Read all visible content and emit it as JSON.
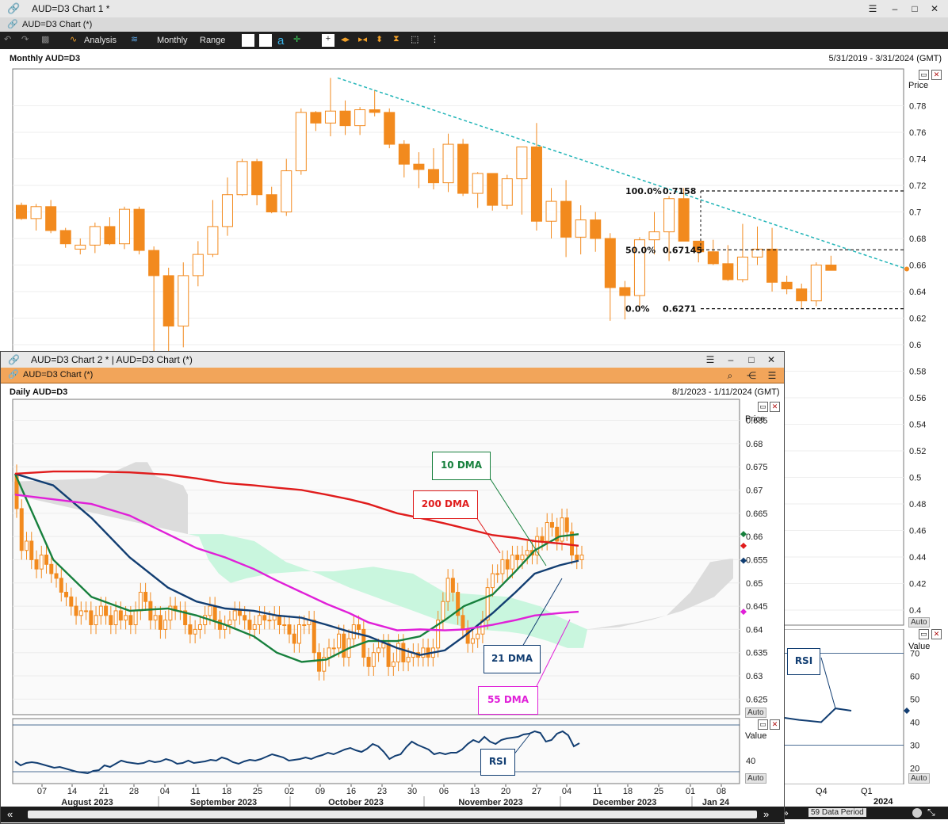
{
  "window1": {
    "title": "AUD=D3 Chart 1 *",
    "subtitle": "AUD=D3 Chart (*)",
    "toolbar": {
      "analysis": "Analysis",
      "interval": "Monthly",
      "range": "Range"
    },
    "chart_title": "Monthly AUD=D3",
    "date_range": "5/31/2019 - 3/31/2024 (GMT)",
    "price_label": "Price",
    "auto_label": "Auto",
    "rsi_value_label": "Value",
    "rsi_label": "RSI",
    "data_period": "59 Data Period",
    "x_labels_visible": [
      "Q4",
      "Q1",
      "2024"
    ],
    "fib_levels": [
      {
        "pct": "100.0%",
        "value": "0.7158"
      },
      {
        "pct": "50.0%",
        "value": "0.67145"
      },
      {
        "pct": "0.0%",
        "value": "0.6271"
      }
    ]
  },
  "window2": {
    "title": "AUD=D3 Chart 2 * | AUD=D3 Chart (*)",
    "subtitle": "AUD=D3 Chart (*)",
    "chart_title": "Daily AUD=D3",
    "date_range": "8/1/2023 - 1/11/2024 (GMT)",
    "price_label": "Price",
    "auto_label": "Auto",
    "rsi_value_label": "Value",
    "rsi_label": "RSI",
    "annotations": {
      "dma10": "10 DMA",
      "dma200": "200 DMA",
      "dma21": "21 DMA",
      "dma55": "55 DMA"
    },
    "months": [
      "August 2023",
      "September 2023",
      "October 2023",
      "November 2023",
      "December 2023",
      "Jan 24"
    ]
  },
  "colors": {
    "candle": "#f28a1e",
    "trendline": "#22b5b8",
    "dma10": "#17803d",
    "dma200": "#e01c1c",
    "dma21": "#123e72",
    "dma55": "#e020d8",
    "cloud": "#c9f6de",
    "cloud_future": "#dcdcdc",
    "rsi": "#123e72"
  },
  "chart_data": [
    {
      "type": "candlestick",
      "title": "Monthly AUD=D3",
      "ylabel": "Price",
      "ylim": [
        0.4,
        0.8
      ],
      "yticks": [
        0.78,
        0.76,
        0.74,
        0.72,
        0.7,
        0.68,
        0.66,
        0.64,
        0.62,
        0.6,
        0.58,
        0.56,
        0.54,
        0.52,
        0.5,
        0.48,
        0.46,
        0.44,
        0.42,
        0.4
      ],
      "yticks_labels": [
        "0.78",
        "0.76",
        "0.74",
        "0.72",
        "0.7",
        "0.68",
        "0.66",
        "0.64",
        "0.62",
        "0.6",
        "0.58",
        "0.56",
        "0.54",
        "0.52",
        "0.5",
        "0.48",
        "0.46",
        "0.44",
        "0.42",
        "0.4"
      ],
      "candles_ohlc": [
        [
          0.705,
          0.707,
          0.694,
          0.695
        ],
        [
          0.695,
          0.706,
          0.686,
          0.704
        ],
        [
          0.704,
          0.709,
          0.684,
          0.686
        ],
        [
          0.686,
          0.688,
          0.673,
          0.676
        ],
        [
          0.672,
          0.68,
          0.668,
          0.675
        ],
        [
          0.675,
          0.692,
          0.669,
          0.689
        ],
        [
          0.689,
          0.696,
          0.675,
          0.676
        ],
        [
          0.676,
          0.704,
          0.672,
          0.702
        ],
        [
          0.702,
          0.704,
          0.668,
          0.671
        ],
        [
          0.671,
          0.674,
          0.595,
          0.652
        ],
        [
          0.652,
          0.658,
          0.574,
          0.614
        ],
        [
          0.614,
          0.662,
          0.598,
          0.652
        ],
        [
          0.652,
          0.678,
          0.644,
          0.668
        ],
        [
          0.668,
          0.709,
          0.666,
          0.689
        ],
        [
          0.689,
          0.726,
          0.682,
          0.713
        ],
        [
          0.713,
          0.74,
          0.712,
          0.738
        ],
        [
          0.738,
          0.74,
          0.705,
          0.713
        ],
        [
          0.713,
          0.719,
          0.699,
          0.7
        ],
        [
          0.7,
          0.74,
          0.697,
          0.731
        ],
        [
          0.731,
          0.778,
          0.728,
          0.775
        ],
        [
          0.775,
          0.776,
          0.761,
          0.767
        ],
        [
          0.767,
          0.801,
          0.757,
          0.776
        ],
        [
          0.776,
          0.784,
          0.758,
          0.765
        ],
        [
          0.765,
          0.779,
          0.758,
          0.777
        ],
        [
          0.777,
          0.792,
          0.772,
          0.775
        ],
        [
          0.775,
          0.778,
          0.748,
          0.751
        ],
        [
          0.751,
          0.754,
          0.726,
          0.736
        ],
        [
          0.736,
          0.745,
          0.718,
          0.732
        ],
        [
          0.732,
          0.748,
          0.717,
          0.722
        ],
        [
          0.722,
          0.759,
          0.715,
          0.751
        ],
        [
          0.751,
          0.755,
          0.712,
          0.714
        ],
        [
          0.714,
          0.73,
          0.703,
          0.729
        ],
        [
          0.729,
          0.729,
          0.701,
          0.705
        ],
        [
          0.705,
          0.728,
          0.702,
          0.725
        ],
        [
          0.725,
          0.732,
          0.698,
          0.749
        ],
        [
          0.749,
          0.767,
          0.686,
          0.693
        ],
        [
          0.693,
          0.718,
          0.68,
          0.708
        ],
        [
          0.708,
          0.724,
          0.666,
          0.681
        ],
        [
          0.681,
          0.705,
          0.668,
          0.694
        ],
        [
          0.694,
          0.7,
          0.67,
          0.68
        ],
        [
          0.68,
          0.684,
          0.618,
          0.643
        ],
        [
          0.643,
          0.648,
          0.619,
          0.637
        ],
        [
          0.637,
          0.681,
          0.628,
          0.679
        ],
        [
          0.679,
          0.7,
          0.668,
          0.685
        ],
        [
          0.685,
          0.712,
          0.663,
          0.71
        ],
        [
          0.71,
          0.718,
          0.68,
          0.678
        ],
        [
          0.678,
          0.678,
          0.662,
          0.67
        ],
        [
          0.67,
          0.679,
          0.66,
          0.661
        ],
        [
          0.661,
          0.675,
          0.648,
          0.649
        ],
        [
          0.649,
          0.691,
          0.647,
          0.666
        ],
        [
          0.666,
          0.689,
          0.66,
          0.672
        ],
        [
          0.672,
          0.688,
          0.64,
          0.647
        ],
        [
          0.647,
          0.652,
          0.638,
          0.642
        ],
        [
          0.642,
          0.646,
          0.627,
          0.633
        ],
        [
          0.633,
          0.662,
          0.629,
          0.66
        ],
        [
          0.66,
          0.667,
          0.657,
          0.656
        ]
      ],
      "trendline": {
        "from_price": 0.801,
        "to_price": 0.657
      },
      "fibonacci": [
        {
          "label": "100.0%",
          "value": 0.7158
        },
        {
          "label": "50.0%",
          "value": 0.67145
        },
        {
          "label": "0.0%",
          "value": 0.6271
        }
      ],
      "rsi": {
        "ylabel": "Value",
        "yticks": [
          70,
          60,
          50,
          40,
          30,
          20
        ],
        "levels": [
          70,
          30
        ],
        "visible_values": [
          42,
          41,
          40,
          46,
          45
        ]
      }
    },
    {
      "type": "candlestick",
      "title": "Daily AUD=D3",
      "ylabel": "Price",
      "ylim": [
        0.622,
        0.688
      ],
      "yticks": [
        0.685,
        0.68,
        0.675,
        0.67,
        0.665,
        0.66,
        0.655,
        0.65,
        0.645,
        0.64,
        0.635,
        0.63,
        0.625
      ],
      "yticks_labels": [
        "0.685",
        "0.68",
        "0.675",
        "0.67",
        "0.665",
        "0.66",
        "0.655",
        "0.65",
        "0.645",
        "0.64",
        "0.635",
        "0.63",
        "0.625"
      ],
      "x_tick_labels": [
        "07",
        "14",
        "21",
        "28",
        "04",
        "11",
        "18",
        "25",
        "02",
        "09",
        "16",
        "23",
        "30",
        "06",
        "13",
        "20",
        "27",
        "04",
        "11",
        "18",
        "25",
        "01",
        "08"
      ],
      "closes": [
        0.666,
        0.657,
        0.659,
        0.655,
        0.653,
        0.656,
        0.654,
        0.652,
        0.651,
        0.648,
        0.647,
        0.645,
        0.643,
        0.644,
        0.644,
        0.641,
        0.643,
        0.645,
        0.643,
        0.641,
        0.644,
        0.642,
        0.643,
        0.641,
        0.644,
        0.648,
        0.646,
        0.642,
        0.643,
        0.64,
        0.642,
        0.645,
        0.644,
        0.644,
        0.641,
        0.639,
        0.64,
        0.641,
        0.643,
        0.645,
        0.642,
        0.64,
        0.641,
        0.642,
        0.644,
        0.643,
        0.642,
        0.64,
        0.641,
        0.643,
        0.642,
        0.642,
        0.643,
        0.641,
        0.641,
        0.639,
        0.637,
        0.641,
        0.641,
        0.642,
        0.635,
        0.631,
        0.634,
        0.636,
        0.636,
        0.639,
        0.634,
        0.638,
        0.641,
        0.64,
        0.634,
        0.632,
        0.635,
        0.636,
        0.637,
        0.632,
        0.633,
        0.637,
        0.633,
        0.634,
        0.635,
        0.634,
        0.636,
        0.634,
        0.636,
        0.642,
        0.646,
        0.651,
        0.648,
        0.643,
        0.64,
        0.637,
        0.638,
        0.639,
        0.642,
        0.649,
        0.652,
        0.652,
        0.655,
        0.653,
        0.656,
        0.655,
        0.656,
        0.657,
        0.656,
        0.66,
        0.659,
        0.663,
        0.662,
        0.659,
        0.664,
        0.661,
        0.656,
        0.655,
        0.656
      ],
      "moving_averages": [
        {
          "name": "10 DMA",
          "points": [
            [
              0,
              0.6735
            ],
            [
              20,
              0.655
            ],
            [
              40,
              0.647
            ],
            [
              60,
              0.644
            ],
            [
              80,
              0.6445
            ],
            [
              95,
              0.643
            ],
            [
              110,
              0.641
            ],
            [
              125,
              0.6385
            ],
            [
              137,
              0.635
            ],
            [
              150,
              0.633
            ],
            [
              163,
              0.6335
            ],
            [
              175,
              0.636
            ],
            [
              185,
              0.6375
            ],
            [
              200,
              0.6375
            ],
            [
              212,
              0.6385
            ],
            [
              225,
              0.642
            ],
            [
              235,
              0.645
            ],
            [
              250,
              0.6475
            ],
            [
              262,
              0.6525
            ],
            [
              272,
              0.657
            ],
            [
              285,
              0.66
            ],
            [
              295,
              0.6605
            ]
          ]
        },
        {
          "name": "21 DMA",
          "points": [
            [
              0,
              0.6735
            ],
            [
              20,
              0.671
            ],
            [
              40,
              0.664
            ],
            [
              60,
              0.6555
            ],
            [
              80,
              0.649
            ],
            [
              95,
              0.646
            ],
            [
              110,
              0.6445
            ],
            [
              125,
              0.644
            ],
            [
              137,
              0.643
            ],
            [
              150,
              0.6425
            ],
            [
              163,
              0.641
            ],
            [
              175,
              0.6395
            ],
            [
              185,
              0.6385
            ],
            [
              200,
              0.636
            ],
            [
              212,
              0.6345
            ],
            [
              225,
              0.6355
            ],
            [
              235,
              0.6385
            ],
            [
              250,
              0.6435
            ],
            [
              262,
              0.648
            ],
            [
              272,
              0.652
            ],
            [
              285,
              0.6538
            ],
            [
              295,
              0.6548
            ]
          ]
        },
        {
          "name": "55 DMA",
          "points": [
            [
              0,
              0.669
            ],
            [
              20,
              0.668
            ],
            [
              40,
              0.667
            ],
            [
              60,
              0.6645
            ],
            [
              80,
              0.6605
            ],
            [
              95,
              0.6575
            ],
            [
              110,
              0.6555
            ],
            [
              125,
              0.653
            ],
            [
              137,
              0.6505
            ],
            [
              150,
              0.648
            ],
            [
              163,
              0.6455
            ],
            [
              175,
              0.6435
            ],
            [
              185,
              0.6415
            ],
            [
              200,
              0.6398
            ],
            [
              212,
              0.64
            ],
            [
              225,
              0.6398
            ],
            [
              235,
              0.64
            ],
            [
              250,
              0.641
            ],
            [
              262,
              0.642
            ],
            [
              272,
              0.643
            ],
            [
              285,
              0.6435
            ],
            [
              295,
              0.6438
            ]
          ]
        },
        {
          "name": "200 DMA",
          "points": [
            [
              0,
              0.6735
            ],
            [
              20,
              0.674
            ],
            [
              40,
              0.674
            ],
            [
              60,
              0.6738
            ],
            [
              80,
              0.6733
            ],
            [
              95,
              0.6725
            ],
            [
              110,
              0.6715
            ],
            [
              125,
              0.671
            ],
            [
              137,
              0.6705
            ],
            [
              150,
              0.67
            ],
            [
              163,
              0.669
            ],
            [
              175,
              0.668
            ],
            [
              185,
              0.667
            ],
            [
              200,
              0.665
            ],
            [
              212,
              0.664
            ],
            [
              225,
              0.6628
            ],
            [
              235,
              0.6618
            ],
            [
              250,
              0.6603
            ],
            [
              262,
              0.6597
            ],
            [
              272,
              0.659
            ],
            [
              285,
              0.6585
            ],
            [
              295,
              0.658
            ]
          ]
        }
      ],
      "rsi": {
        "ylabel": "Value",
        "yticks": [
          40
        ]
      }
    }
  ]
}
